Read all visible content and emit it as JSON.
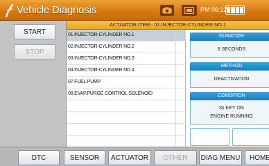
{
  "titlebar": {
    "title": "Vehicle Diagnosis",
    "clock": "PM 06:12",
    "icons": [
      "logo-icon",
      "camera-icon",
      "screen-icon",
      "battery-icon"
    ]
  },
  "controls": {
    "start_label": "START",
    "stop_label": "STOP"
  },
  "header": {
    "text": "ACTUATOR ITEM - 01.INJECTOR-CYLINDER NO.1"
  },
  "list": {
    "items": [
      "01.INJECTOR-CYLINDER NO.1",
      "02.INJECTOR-CYLINDER NO.2",
      "03.INJECTOR-CYLINDER NO.3",
      "04.INJECTOR-CYLINDER NO.4",
      "07.FUEL PUMP",
      "08.EVAP.PURGE CONTROL SOLENOID"
    ],
    "selected_index": 0
  },
  "info": {
    "duration_title": "DURATION",
    "duration_value": "6 SECONDS",
    "method_title": "METHOD",
    "method_value": "DEACTIVATION",
    "condition_title": "CONDITION",
    "condition_line1": "IG.KEY ON",
    "condition_line2": "ENGINE RUNNING"
  },
  "tabs": {
    "dtc": "DTC",
    "sensor": "SENSOR",
    "actuator": "ACTUATOR",
    "other": "OTHER",
    "diag_menu": "DIAG MENU",
    "home": "HOME"
  },
  "colors": {
    "titlebar": "#e08a1e",
    "header": "#f0b43a",
    "info_header": "#2a8fcd",
    "selected_row": "#c9cfd8"
  }
}
